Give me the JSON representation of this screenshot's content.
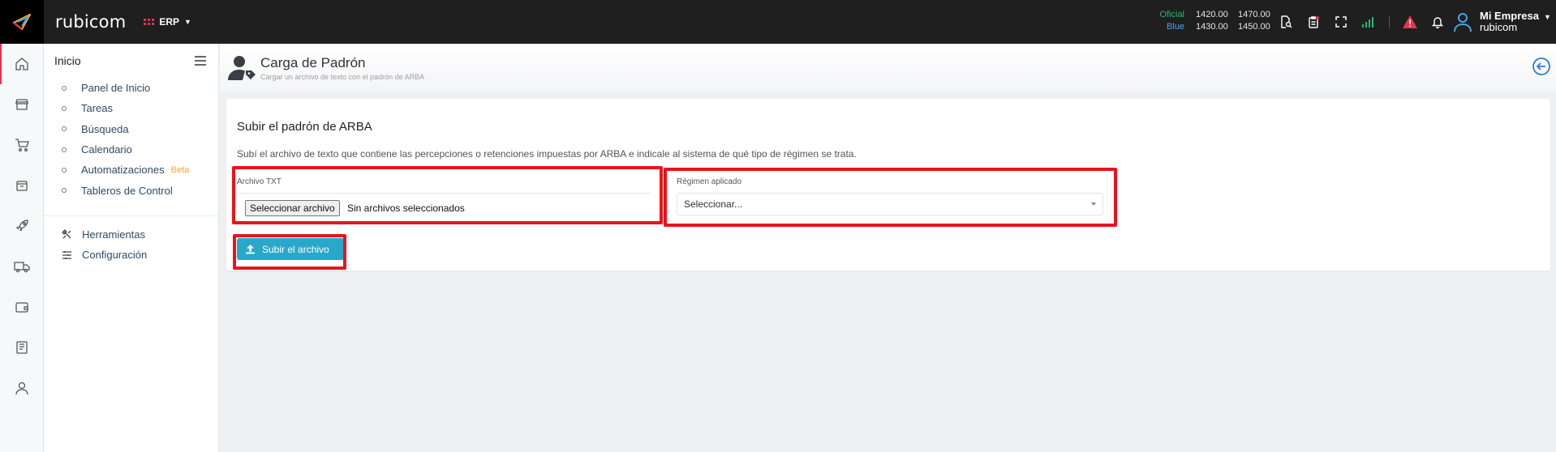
{
  "app": {
    "brand": "rubicom",
    "module": "ERP"
  },
  "rates": [
    {
      "label": "Oficial",
      "buy": "1420.00",
      "sell": "1470.00"
    },
    {
      "label": "Blue",
      "buy": "1430.00",
      "sell": "1450.00"
    }
  ],
  "user": {
    "name": "Mi Empresa",
    "company": "rubicom"
  },
  "nav": {
    "title": "Inicio",
    "items": [
      {
        "label": "Panel de Inicio"
      },
      {
        "label": "Tareas"
      },
      {
        "label": "Búsqueda"
      },
      {
        "label": "Calendario"
      },
      {
        "label": "Automatizaciones",
        "badge": "Beta"
      },
      {
        "label": "Tableros de Control"
      }
    ],
    "tools": [
      {
        "label": "Herramientas",
        "icon": "tools-icon"
      },
      {
        "label": "Configuración",
        "icon": "sliders-icon"
      }
    ]
  },
  "page": {
    "title": "Carga de Padrón",
    "subtitle": "Cargar un archivo de texto con el padrón de ARBA"
  },
  "form": {
    "heading": "Subir el padrón de ARBA",
    "description": "Subí el archivo de texto que contiene las percepciones o retenciones impuestas por ARBA e indicale al sistema de qué tipo de régimen se trata.",
    "file_label": "Archivo TXT",
    "file_button": "Seleccionar archivo",
    "file_status": "Sin archivos seleccionados",
    "regimen_label": "Régimen aplicado",
    "regimen_value": "Seleccionar...",
    "submit_label": "Subir el archivo"
  },
  "colors": {
    "accent": "#2aa8c9",
    "highlight": "#e8141c",
    "brand_red": "#e8344e"
  }
}
